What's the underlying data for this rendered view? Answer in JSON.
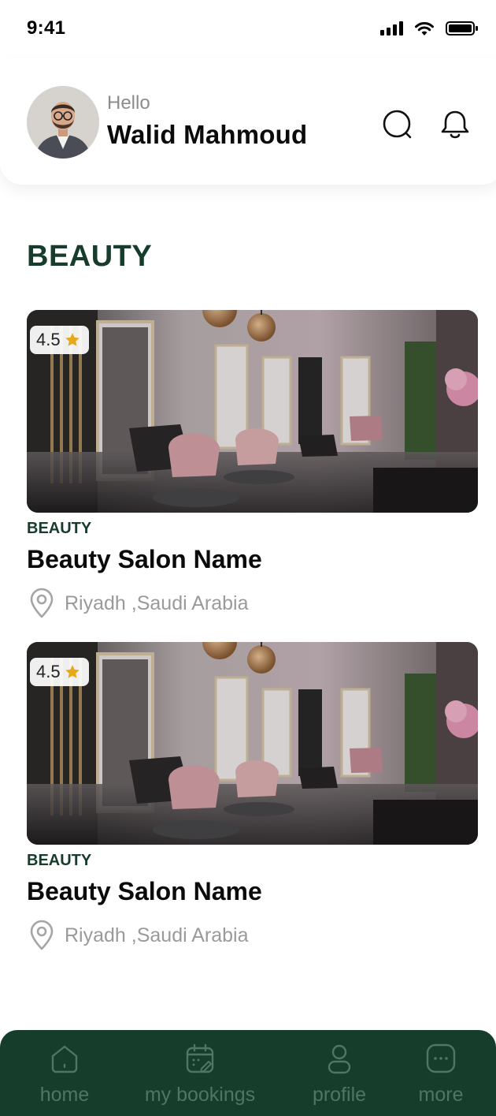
{
  "status_bar": {
    "time": "9:41",
    "icons": [
      "signal-icon",
      "wifi-icon",
      "battery-icon"
    ]
  },
  "header": {
    "greeting": "Hello",
    "user_name": "Walid Mahmoud",
    "icons": [
      "search-icon",
      "bell-icon"
    ]
  },
  "section": {
    "title": "BEAUTY"
  },
  "cards": [
    {
      "rating": "4.5",
      "category": "BEAUTY",
      "title": "Beauty Salon Name",
      "location": "Riyadh ,Saudi Arabia"
    },
    {
      "rating": "4.5",
      "category": "BEAUTY",
      "title": "Beauty Salon Name",
      "location": "Riyadh ,Saudi Arabia"
    }
  ],
  "bottom_nav": {
    "items": [
      {
        "label": "home",
        "icon": "home-icon"
      },
      {
        "label": "my bookings",
        "icon": "calendar-icon"
      },
      {
        "label": "profile",
        "icon": "person-icon"
      },
      {
        "label": "more",
        "icon": "more-icon"
      }
    ]
  },
  "colors": {
    "brand_green": "#163d2c",
    "nav_inactive": "#4f7563",
    "star": "#e6a817",
    "muted_text": "#9a9a9a"
  }
}
